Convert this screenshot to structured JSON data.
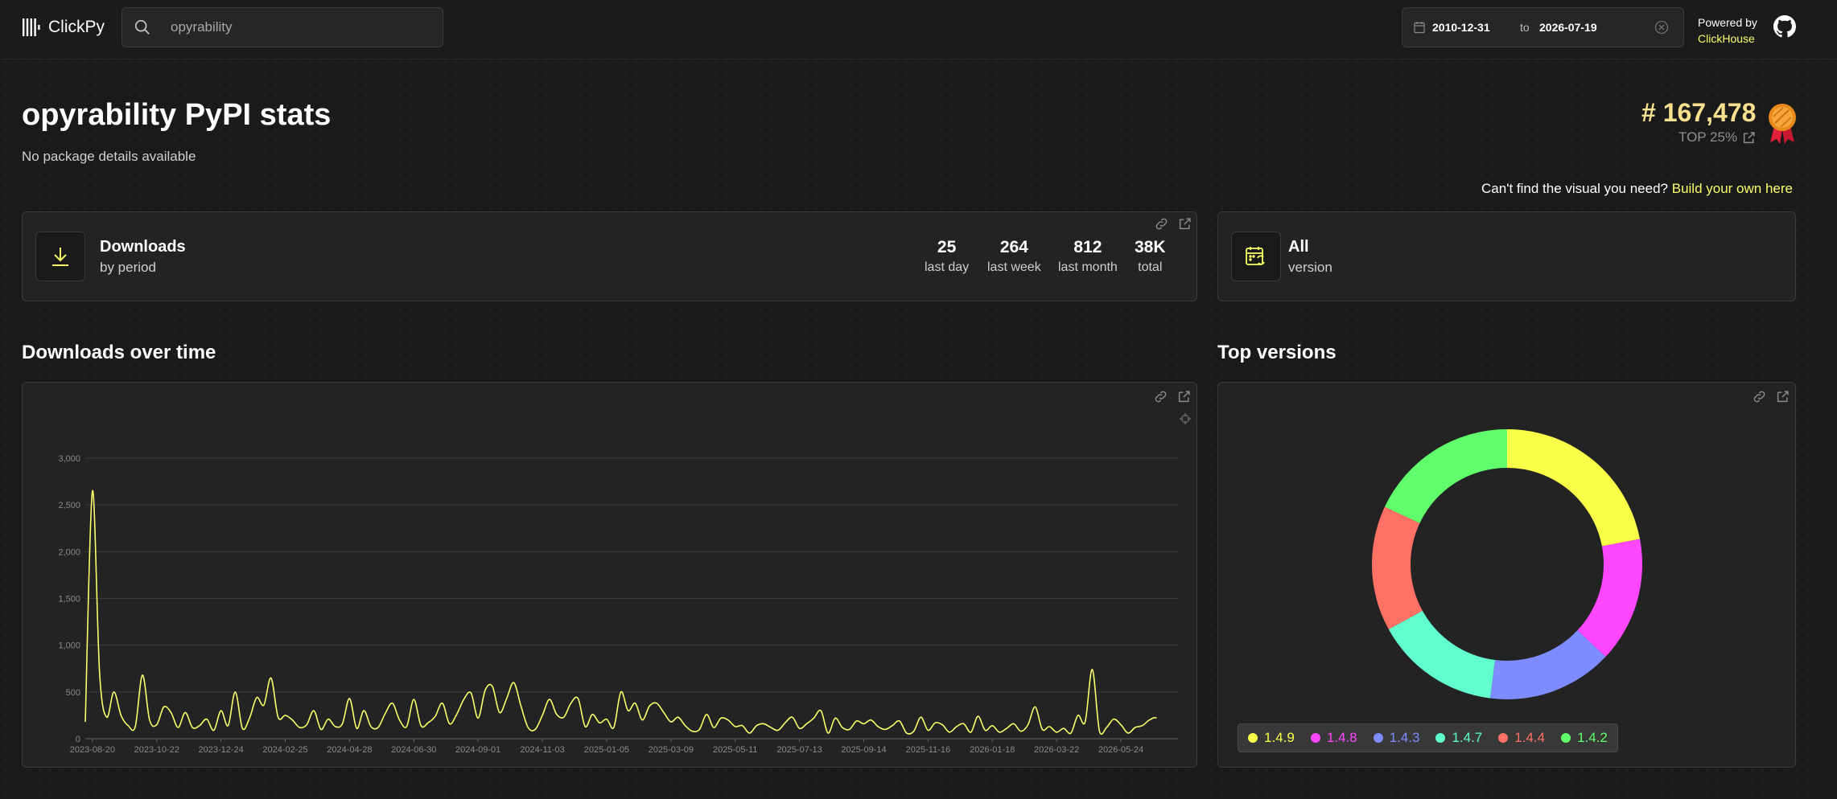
{
  "header": {
    "logo_text": "ClickPy",
    "search_value": "opyrability",
    "date_from": "2010-12-31",
    "date_to_label": "to",
    "date_to": "2026-07-19",
    "powered_by": "Powered by",
    "powered_brand": "ClickHouse"
  },
  "page": {
    "title": "opyrability PyPI stats",
    "subtitle": "No package details available",
    "rank": "# 167,478",
    "top_percent": "TOP 25%",
    "cant_find": "Can't find the visual you need?",
    "build_link": "Build your own here"
  },
  "downloads_card": {
    "title": "Downloads",
    "subtitle": "by period",
    "stats": [
      {
        "value": "25",
        "label": "last day"
      },
      {
        "value": "264",
        "label": "last week"
      },
      {
        "value": "812",
        "label": "last month"
      },
      {
        "value": "38K",
        "label": "total"
      }
    ]
  },
  "version_card": {
    "title": "All",
    "subtitle": "version"
  },
  "sections": {
    "downloads_over_time": "Downloads over time",
    "top_versions": "Top versions"
  },
  "colors": {
    "accent": "#faff69",
    "background": "#1a1a1a",
    "card": "#232323",
    "rank": "#f8e08e"
  },
  "chart_data": [
    {
      "type": "line",
      "title": "Downloads over time",
      "ylim": [
        0,
        3000
      ],
      "y_ticks": [
        "0",
        "500",
        "1,000",
        "1,500",
        "2,000",
        "2,500",
        "3,000"
      ],
      "x_ticks": [
        "2023-08-20",
        "2023-10-22",
        "2023-12-24",
        "2024-02-25",
        "2024-04-28",
        "2024-06-30",
        "2024-09-01",
        "2024-11-03",
        "2025-01-05",
        "2025-03-09",
        "2025-05-11",
        "2025-07-13",
        "2025-09-14",
        "2025-11-16",
        "2026-01-18",
        "2026-03-22",
        "2026-05-24"
      ],
      "color": "#faff69",
      "x": [
        "2023-08-13",
        "2023-08-20",
        "2023-08-27",
        "2023-09-03",
        "2023-09-10",
        "2023-09-17",
        "2023-09-24",
        "2023-10-01",
        "2023-10-08",
        "2023-10-15",
        "2023-10-22",
        "2023-10-29",
        "2023-11-05",
        "2023-11-12",
        "2023-11-19",
        "2023-11-26",
        "2023-12-03",
        "2023-12-10",
        "2023-12-17",
        "2023-12-24",
        "2023-12-31",
        "2024-01-07",
        "2024-01-14",
        "2024-01-21",
        "2024-01-28",
        "2024-02-04",
        "2024-02-11",
        "2024-02-18",
        "2024-02-25",
        "2024-03-03",
        "2024-03-10",
        "2024-03-17",
        "2024-03-24",
        "2024-03-31",
        "2024-04-07",
        "2024-04-14",
        "2024-04-21",
        "2024-04-28",
        "2024-05-05",
        "2024-05-12",
        "2024-05-19",
        "2024-05-26",
        "2024-06-02",
        "2024-06-09",
        "2024-06-16",
        "2024-06-23",
        "2024-06-30",
        "2024-07-07",
        "2024-07-14",
        "2024-07-21",
        "2024-07-28",
        "2024-08-04",
        "2024-08-11",
        "2024-08-18",
        "2024-08-25",
        "2024-09-01",
        "2024-09-08",
        "2024-09-15",
        "2024-09-22",
        "2024-09-29",
        "2024-10-06",
        "2024-10-13",
        "2024-10-20",
        "2024-10-27",
        "2024-11-03",
        "2024-11-10",
        "2024-11-17",
        "2024-11-24",
        "2024-12-01",
        "2024-12-08",
        "2024-12-15",
        "2024-12-22",
        "2024-12-29",
        "2025-01-05",
        "2025-01-12",
        "2025-01-19",
        "2025-01-26",
        "2025-02-02",
        "2025-02-09",
        "2025-02-16",
        "2025-02-23",
        "2025-03-02",
        "2025-03-09",
        "2025-03-16",
        "2025-03-23",
        "2025-03-30",
        "2025-04-06",
        "2025-04-13",
        "2025-04-20",
        "2025-04-27",
        "2025-05-04",
        "2025-05-11",
        "2025-05-18",
        "2025-05-25",
        "2025-06-01",
        "2025-06-08",
        "2025-06-15",
        "2025-06-22",
        "2025-06-29",
        "2025-07-06",
        "2025-07-13",
        "2025-07-20",
        "2025-07-27",
        "2025-08-03",
        "2025-08-10",
        "2025-08-17",
        "2025-08-24",
        "2025-08-31",
        "2025-09-07",
        "2025-09-14",
        "2025-09-21",
        "2025-09-28",
        "2025-10-05",
        "2025-10-12",
        "2025-10-19",
        "2025-10-26",
        "2025-11-02",
        "2025-11-09",
        "2025-11-16",
        "2025-11-23",
        "2025-11-30",
        "2025-12-07",
        "2025-12-14",
        "2025-12-21",
        "2025-12-28",
        "2026-01-04",
        "2026-01-11",
        "2026-01-18",
        "2026-01-25",
        "2026-02-01",
        "2026-02-08",
        "2026-02-15",
        "2026-02-22",
        "2026-03-01",
        "2026-03-08",
        "2026-03-15",
        "2026-03-22",
        "2026-03-29",
        "2026-04-05",
        "2026-04-12",
        "2026-04-19",
        "2026-04-26",
        "2026-05-03",
        "2026-05-10",
        "2026-05-17",
        "2026-05-24",
        "2026-05-31",
        "2026-06-07",
        "2026-06-14",
        "2026-06-21",
        "2026-06-28",
        "2026-07-05",
        "2026-07-12",
        "2026-07-19"
      ],
      "values": [
        180,
        2650,
        700,
        230,
        500,
        250,
        140,
        130,
        680,
        200,
        150,
        340,
        280,
        120,
        280,
        120,
        140,
        210,
        90,
        300,
        140,
        500,
        110,
        220,
        440,
        360,
        650,
        230,
        250,
        200,
        120,
        150,
        300,
        100,
        210,
        130,
        160,
        430,
        110,
        300,
        130,
        120,
        270,
        380,
        200,
        130,
        420,
        140,
        170,
        240,
        380,
        160,
        260,
        420,
        490,
        220,
        520,
        560,
        280,
        430,
        600,
        350,
        120,
        100,
        250,
        420,
        260,
        230,
        380,
        430,
        130,
        260,
        170,
        210,
        120,
        500,
        300,
        380,
        200,
        350,
        380,
        280,
        180,
        230,
        140,
        80,
        100,
        260,
        120,
        220,
        200,
        130,
        140,
        60,
        140,
        160,
        120,
        90,
        170,
        230,
        110,
        160,
        220,
        300,
        60,
        220,
        120,
        100,
        190,
        160,
        200,
        130,
        100,
        140,
        190,
        60,
        80,
        230,
        90,
        170,
        150,
        70,
        130,
        160,
        70,
        240,
        90,
        140,
        70,
        110,
        160,
        80,
        150,
        340,
        100,
        130,
        70,
        110,
        60,
        250,
        180,
        740,
        80,
        120,
        210,
        150,
        60,
        120,
        140,
        200,
        220,
        100
      ],
      "grid": true
    },
    {
      "type": "pie",
      "title": "Top versions",
      "variant": "donut",
      "categories": [
        "1.4.9",
        "1.4.8",
        "1.4.3",
        "1.4.7",
        "1.4.4",
        "1.4.2"
      ],
      "values": [
        22,
        15,
        15,
        15,
        15,
        18
      ],
      "colors": [
        "#f9ff48",
        "#ff47ff",
        "#7f8cff",
        "#61ffce",
        "#ff7065",
        "#61ff6c"
      ],
      "legend_position": "bottom-left"
    }
  ]
}
